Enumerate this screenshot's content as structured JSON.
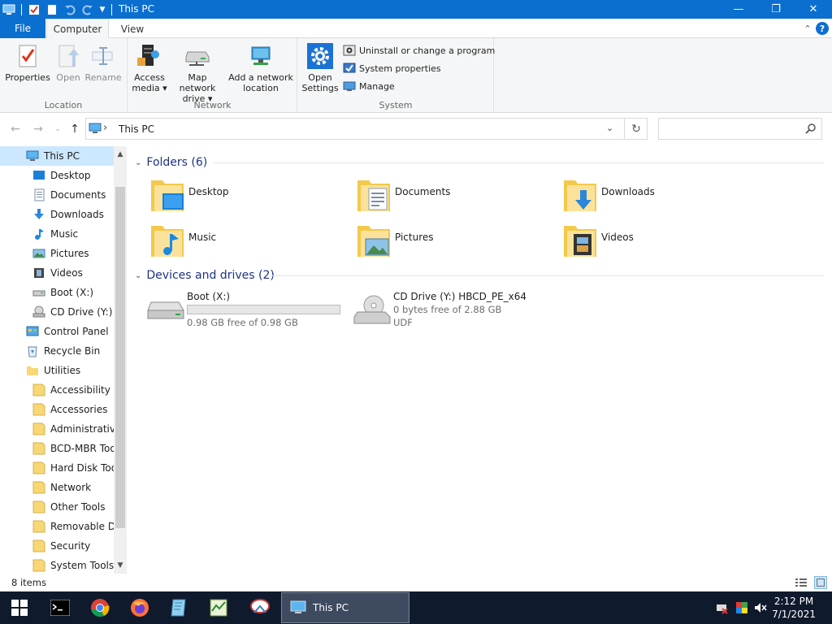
{
  "window": {
    "title": "This PC",
    "minimize_label": "—",
    "maximize_label": "❐",
    "close_label": "✕"
  },
  "ribbon_tabs": {
    "file": "File",
    "computer": "Computer",
    "view": "View",
    "collapse_label": "⌃",
    "help_label": "?"
  },
  "ribbon": {
    "location": {
      "label": "Location",
      "properties": "Properties",
      "open": "Open",
      "rename": "Rename"
    },
    "network": {
      "label": "Network",
      "access_media_1": "Access",
      "access_media_2": "media ▾",
      "map_drive_1": "Map network",
      "map_drive_2": "drive ▾",
      "add_location_1": "Add a network",
      "add_location_2": "location"
    },
    "system": {
      "label": "System",
      "open_settings_1": "Open",
      "open_settings_2": "Settings",
      "uninstall": "Uninstall or change a program",
      "system_properties": "System properties",
      "manage": "Manage"
    }
  },
  "address": {
    "path": "This PC",
    "chevron": "›",
    "dropdown": "⌄",
    "refresh": "↻",
    "back": "←",
    "forward": "→",
    "recent": "⌄",
    "up": "↑",
    "search_placeholder": ""
  },
  "nav_pane": {
    "items": [
      {
        "label": "This PC"
      },
      {
        "label": "Desktop"
      },
      {
        "label": "Documents"
      },
      {
        "label": "Downloads"
      },
      {
        "label": "Music"
      },
      {
        "label": "Pictures"
      },
      {
        "label": "Videos"
      },
      {
        "label": "Boot (X:)"
      },
      {
        "label": "CD Drive (Y:) H"
      },
      {
        "label": "Control Panel"
      },
      {
        "label": "Recycle Bin"
      },
      {
        "label": "Utilities"
      },
      {
        "label": "Accessibility"
      },
      {
        "label": "Accessories"
      },
      {
        "label": "Administrative"
      },
      {
        "label": "BCD-MBR Tool"
      },
      {
        "label": "Hard Disk Tools"
      },
      {
        "label": "Network"
      },
      {
        "label": "Other Tools"
      },
      {
        "label": "Removable Dri"
      },
      {
        "label": "Security"
      },
      {
        "label": "System Tools"
      }
    ],
    "scroll_up": "▲",
    "scroll_down": "▼"
  },
  "content": {
    "folders_header": "Folders (6)",
    "folders": [
      {
        "name": "Desktop"
      },
      {
        "name": "Documents"
      },
      {
        "name": "Downloads"
      },
      {
        "name": "Music"
      },
      {
        "name": "Pictures"
      },
      {
        "name": "Videos"
      }
    ],
    "drives_header": "Devices and drives (2)",
    "drives": [
      {
        "name": "Boot (X:)",
        "info": "0.98 GB free of 0.98 GB",
        "used_fraction": 0.0
      },
      {
        "name": "CD Drive (Y:) HBCD_PE_x64",
        "info": "0 bytes free of 2.88 GB",
        "fs": "UDF"
      }
    ],
    "section_chevron": "⌄"
  },
  "status": {
    "items_count": "8 items"
  },
  "taskbar": {
    "active_window": "This PC",
    "time": "2:12 PM",
    "date": "7/1/2021"
  },
  "colors": {
    "accent": "#0b6fd0",
    "selection": "#cce8ff",
    "taskbar": "#101a2d",
    "section_header": "#1e3287"
  }
}
